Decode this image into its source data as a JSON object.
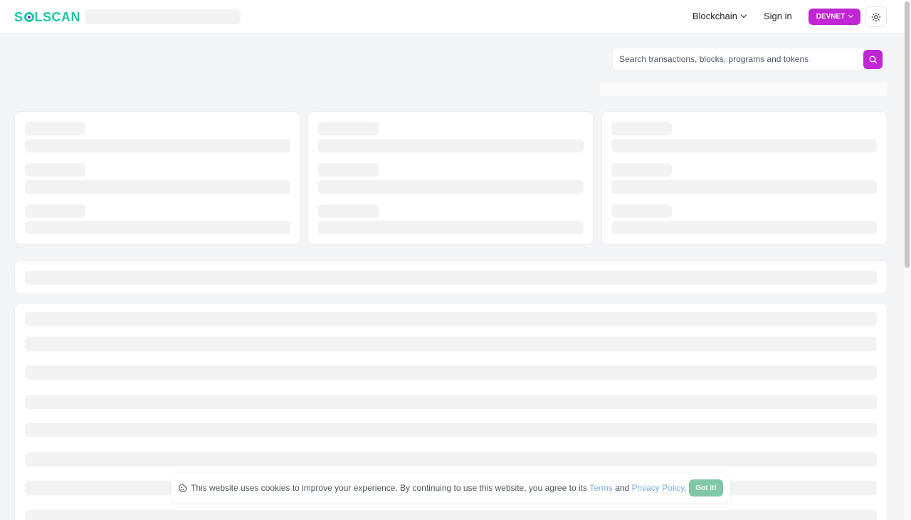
{
  "header": {
    "logo_left": "S",
    "logo_right": "LSCAN",
    "nav_blockchain": "Blockchain",
    "nav_signin": "Sign in",
    "network": "DEVNET"
  },
  "search": {
    "placeholder": "Search transactions, blocks, programs and tokens"
  },
  "cookie": {
    "text": "This website uses cookies to improve your experience. By continuing to use this website, you agree to its",
    "terms": "Terms",
    "and": "and",
    "privacy": "Privacy Policy",
    "period": ".",
    "button": "Got it!"
  },
  "colors": {
    "brand": "#19c9a6",
    "accent": "#c026d3",
    "cookie_button": "#7fc7a8",
    "link": "#7aaee3"
  },
  "icons": {
    "search": "search-icon",
    "theme": "sun-icon",
    "cookie": "cookie-icon"
  }
}
